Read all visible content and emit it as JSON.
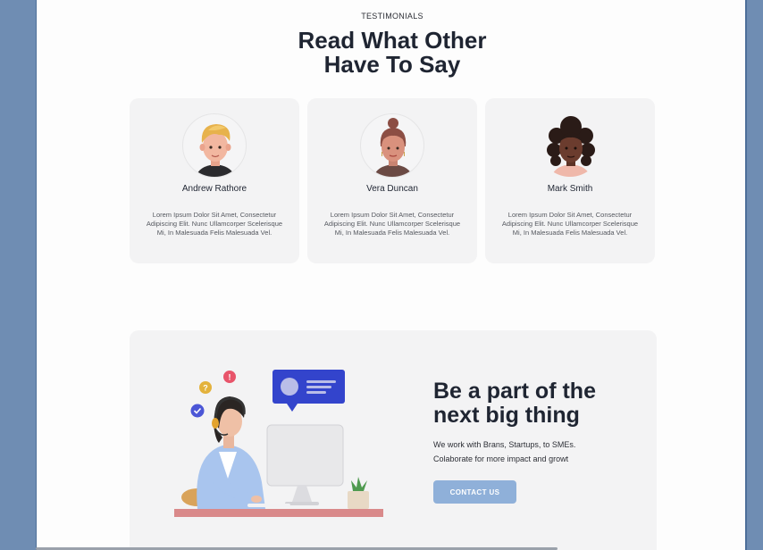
{
  "testimonials": {
    "eyebrow": "TESTIMONIALS",
    "heading_line1": "Read What Other",
    "heading_line2": "Have To Say",
    "cards": [
      {
        "name": "Andrew Rathore",
        "text": "Lorem Ipsum Dolor Sit Amet, Consectetur Adipiscing Elit. Nunc Ullamcorper Scelerisque Mi, In Malesuada Felis Malesuada Vel."
      },
      {
        "name": "Vera Duncan",
        "text": "Lorem Ipsum Dolor Sit Amet, Consectetur Adipiscing Elit. Nunc Ullamcorper Scelerisque Mi, In Malesuada Felis Malesuada Vel."
      },
      {
        "name": "Mark Smith",
        "text": "Lorem Ipsum Dolor Sit Amet, Consectetur Adipiscing Elit. Nunc Ullamcorper Scelerisque Mi, In Malesuada Felis Malesuada Vel."
      }
    ]
  },
  "cta": {
    "title_line1": "Be a part of the",
    "title_line2": "next big thing",
    "line1": "We work with Brans, Startups, to SMEs.",
    "line2": "Colaborate for more impact and growt",
    "button_label": "CONTACT US"
  },
  "colors": {
    "outer_background": "#6f8db3",
    "page_background": "#fdfdfd",
    "card_background": "#f3f3f4",
    "heading_text": "#1f2532",
    "button_background": "#8fb0d9",
    "chat_bubble": "#3344cc"
  }
}
